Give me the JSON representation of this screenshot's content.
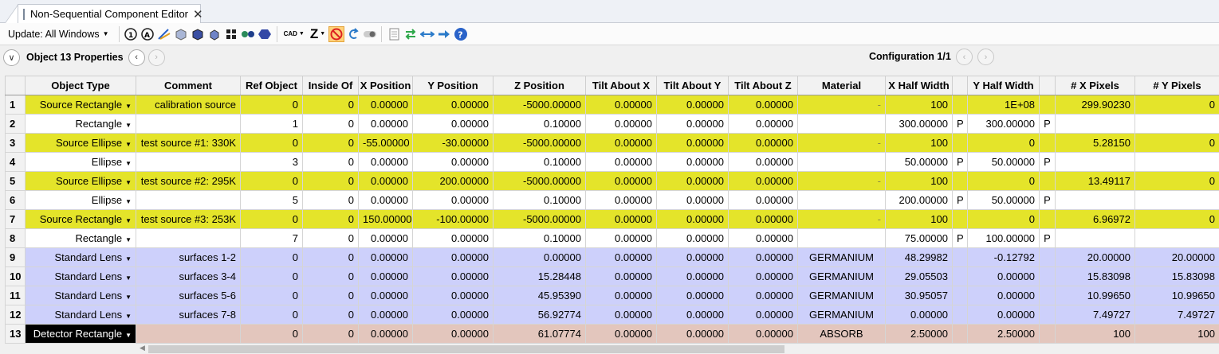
{
  "tab": {
    "title": "Non-Sequential Component Editor",
    "close": "✕"
  },
  "toolbar": {
    "update_label": "Update: All Windows",
    "cad_label": "CAD",
    "z_label": "Z",
    "icons": [
      "settings-1-icon",
      "settings-2-icon",
      "ray-trace-icon",
      "shaded-model-icon",
      "solid-model-icon",
      "layout-icon",
      "grid-icon",
      "dots-icon",
      "hexagon-icon",
      "cad-icon",
      "z-icon",
      "no-icon",
      "undo-icon",
      "toggle-icon",
      "page-icon",
      "swap-icon",
      "arrows-icon",
      "right-arrow-icon",
      "help-icon"
    ]
  },
  "objbar": {
    "label": "Object  13 Properties",
    "config": "Configuration 1/1"
  },
  "columns": [
    "Object Type",
    "Comment",
    "Ref Object",
    "Inside Of",
    "X Position",
    "Y Position",
    "Z Position",
    "Tilt About X",
    "Tilt About Y",
    "Tilt About Z",
    "Material",
    "X Half Width",
    "",
    "Y Half Width",
    "",
    "# X Pixels",
    "# Y Pixels"
  ],
  "rows": [
    {
      "n": "1",
      "type": "Source Rectangle",
      "comment": "calibration source",
      "ref": "0",
      "inside": "0",
      "x": "0.00000",
      "y": "0.00000",
      "z": "-5000.00000",
      "tx": "0.00000",
      "ty": "0.00000",
      "tz": "0.00000",
      "mat": "-",
      "xhw": "100",
      "xf": "",
      "yhw": "1E+08",
      "yf": "",
      "xp": "299.90230",
      "yp": "0",
      "kind": "source"
    },
    {
      "n": "2",
      "type": "Rectangle",
      "comment": "",
      "ref": "1",
      "inside": "0",
      "x": "0.00000",
      "y": "0.00000",
      "z": "0.10000",
      "tx": "0.00000",
      "ty": "0.00000",
      "tz": "0.00000",
      "mat": "",
      "xhw": "300.00000",
      "xf": "P",
      "yhw": "300.00000",
      "yf": "P",
      "xp": "",
      "yp": "",
      "kind": "plain"
    },
    {
      "n": "3",
      "type": "Source Ellipse",
      "comment": "test source #1: 330K",
      "ref": "0",
      "inside": "0",
      "x": "-55.00000",
      "y": "-30.00000",
      "z": "-5000.00000",
      "tx": "0.00000",
      "ty": "0.00000",
      "tz": "0.00000",
      "mat": "-",
      "xhw": "100",
      "xf": "",
      "yhw": "0",
      "yf": "",
      "xp": "5.28150",
      "yp": "0",
      "kind": "source"
    },
    {
      "n": "4",
      "type": "Ellipse",
      "comment": "",
      "ref": "3",
      "inside": "0",
      "x": "0.00000",
      "y": "0.00000",
      "z": "0.10000",
      "tx": "0.00000",
      "ty": "0.00000",
      "tz": "0.00000",
      "mat": "",
      "xhw": "50.00000",
      "xf": "P",
      "yhw": "50.00000",
      "yf": "P",
      "xp": "",
      "yp": "",
      "kind": "plain"
    },
    {
      "n": "5",
      "type": "Source Ellipse",
      "comment": "test source #2: 295K",
      "ref": "0",
      "inside": "0",
      "x": "0.00000",
      "y": "200.00000",
      "z": "-5000.00000",
      "tx": "0.00000",
      "ty": "0.00000",
      "tz": "0.00000",
      "mat": "-",
      "xhw": "100",
      "xf": "",
      "yhw": "0",
      "yf": "",
      "xp": "13.49117",
      "yp": "0",
      "kind": "source"
    },
    {
      "n": "6",
      "type": "Ellipse",
      "comment": "",
      "ref": "5",
      "inside": "0",
      "x": "0.00000",
      "y": "0.00000",
      "z": "0.10000",
      "tx": "0.00000",
      "ty": "0.00000",
      "tz": "0.00000",
      "mat": "",
      "xhw": "200.00000",
      "xf": "P",
      "yhw": "50.00000",
      "yf": "P",
      "xp": "",
      "yp": "",
      "kind": "plain"
    },
    {
      "n": "7",
      "type": "Source Rectangle",
      "comment": "test source #3: 253K",
      "ref": "0",
      "inside": "0",
      "x": "150.00000",
      "y": "-100.00000",
      "z": "-5000.00000",
      "tx": "0.00000",
      "ty": "0.00000",
      "tz": "0.00000",
      "mat": "-",
      "xhw": "100",
      "xf": "",
      "yhw": "0",
      "yf": "",
      "xp": "6.96972",
      "yp": "0",
      "kind": "source"
    },
    {
      "n": "8",
      "type": "Rectangle",
      "comment": "",
      "ref": "7",
      "inside": "0",
      "x": "0.00000",
      "y": "0.00000",
      "z": "0.10000",
      "tx": "0.00000",
      "ty": "0.00000",
      "tz": "0.00000",
      "mat": "",
      "xhw": "75.00000",
      "xf": "P",
      "yhw": "100.00000",
      "yf": "P",
      "xp": "",
      "yp": "",
      "kind": "plain"
    },
    {
      "n": "9",
      "type": "Standard Lens",
      "comment": "surfaces 1-2",
      "ref": "0",
      "inside": "0",
      "x": "0.00000",
      "y": "0.00000",
      "z": "0.00000",
      "tx": "0.00000",
      "ty": "0.00000",
      "tz": "0.00000",
      "mat": "GERMANIUM",
      "xhw": "48.29982",
      "xf": "",
      "yhw": "-0.12792",
      "yf": "",
      "xp": "20.00000",
      "yp": "20.00000",
      "kind": "lens"
    },
    {
      "n": "10",
      "type": "Standard Lens",
      "comment": "surfaces 3-4",
      "ref": "0",
      "inside": "0",
      "x": "0.00000",
      "y": "0.00000",
      "z": "15.28448",
      "tx": "0.00000",
      "ty": "0.00000",
      "tz": "0.00000",
      "mat": "GERMANIUM",
      "xhw": "29.05503",
      "xf": "",
      "yhw": "0.00000",
      "yf": "",
      "xp": "15.83098",
      "yp": "15.83098",
      "kind": "lens"
    },
    {
      "n": "11",
      "type": "Standard Lens",
      "comment": "surfaces 5-6",
      "ref": "0",
      "inside": "0",
      "x": "0.00000",
      "y": "0.00000",
      "z": "45.95390",
      "tx": "0.00000",
      "ty": "0.00000",
      "tz": "0.00000",
      "mat": "GERMANIUM",
      "xhw": "30.95057",
      "xf": "",
      "yhw": "0.00000",
      "yf": "",
      "xp": "10.99650",
      "yp": "10.99650",
      "kind": "lens"
    },
    {
      "n": "12",
      "type": "Standard Lens",
      "comment": "surfaces 7-8",
      "ref": "0",
      "inside": "0",
      "x": "0.00000",
      "y": "0.00000",
      "z": "56.92774",
      "tx": "0.00000",
      "ty": "0.00000",
      "tz": "0.00000",
      "mat": "GERMANIUM",
      "xhw": "0.00000",
      "xf": "",
      "yhw": "0.00000",
      "yf": "",
      "xp": "7.49727",
      "yp": "7.49727",
      "kind": "lens"
    },
    {
      "n": "13",
      "type": "Detector Rectangle",
      "comment": "",
      "ref": "0",
      "inside": "0",
      "x": "0.00000",
      "y": "0.00000",
      "z": "61.07774",
      "tx": "0.00000",
      "ty": "0.00000",
      "tz": "0.00000",
      "mat": "ABSORB",
      "xhw": "2.50000",
      "xf": "",
      "yhw": "2.50000",
      "yf": "",
      "xp": "100",
      "yp": "100",
      "kind": "det"
    }
  ],
  "colors": {
    "source": "#e4e42a",
    "lens": "#cdd0fb",
    "detector": "#e3c6bd",
    "selected": "#000000"
  }
}
